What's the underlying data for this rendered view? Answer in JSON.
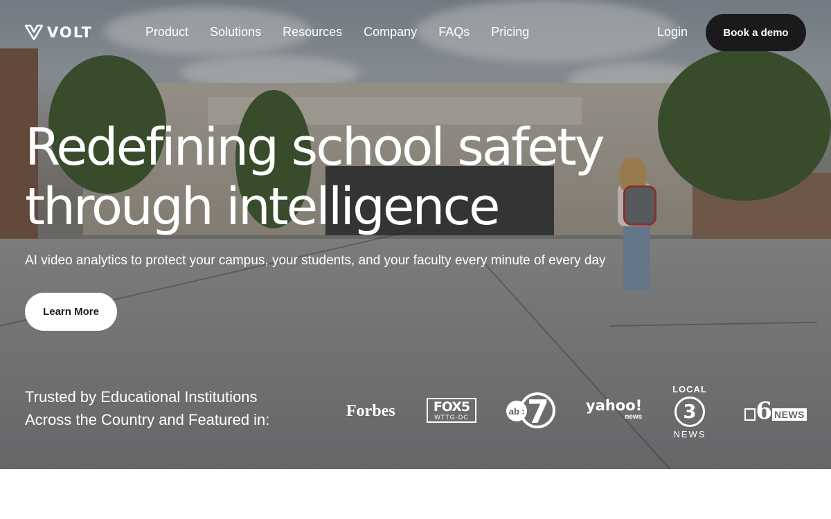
{
  "brand": {
    "name": "VOLT"
  },
  "nav": {
    "links": [
      "Product",
      "Solutions",
      "Resources",
      "Company",
      "FAQs",
      "Pricing"
    ],
    "login_label": "Login",
    "demo_label": "Book a demo"
  },
  "hero": {
    "headline_line1": "Redefining school safety",
    "headline_line2": "through intelligence",
    "subheadline": "AI video analytics to protect your campus, your students, and your faculty every minute of every day",
    "cta_label": "Learn More"
  },
  "trusted": {
    "line1": "Trusted by Educational Institutions",
    "line2": "Across the Country and Featured in:"
  },
  "press": {
    "forbes": "Forbes",
    "fox_big": "FOX5",
    "fox_small": "WTTG·DC",
    "abc": "abc",
    "abc_num": "7",
    "yahoo_top": "yahoo!",
    "yahoo_bottom": "news",
    "local3_top": "LOCAL",
    "local3_num": "3",
    "local3_bottom": "NEWS",
    "news6_num": "6",
    "news6_label": "NEWS"
  },
  "colors": {
    "demo_button": "#1a1a1c",
    "cta_button": "#ffffff",
    "text_on_hero": "#ffffff"
  }
}
